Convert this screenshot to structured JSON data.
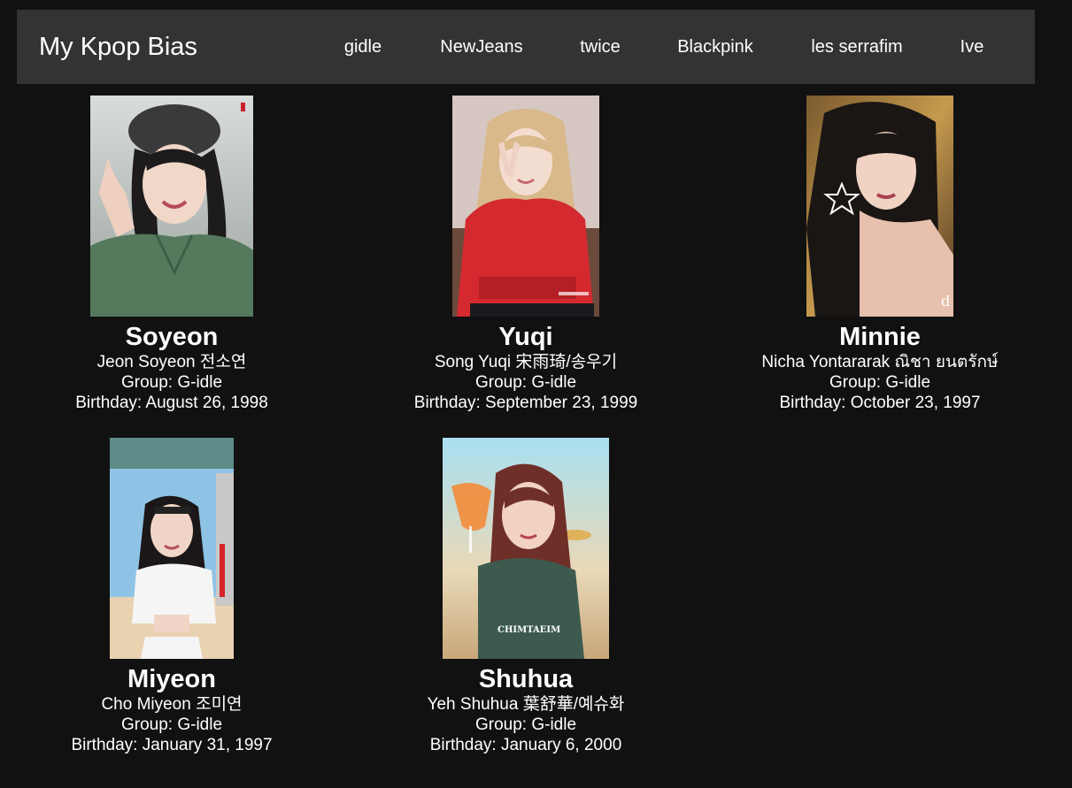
{
  "navbar": {
    "brand": "My Kpop Bias",
    "links": [
      "gidle",
      "NewJeans",
      "twice",
      "Blackpink",
      "les serrafim",
      "Ive"
    ]
  },
  "members": [
    {
      "name": "Soyeon",
      "full_name": "Jeon Soyeon 전소연",
      "group": "Group: G-idle",
      "birthday": "Birthday: August 26, 1998",
      "photo": "soyeon-photo"
    },
    {
      "name": "Yuqi",
      "full_name": "Song Yuqi 宋雨琦/송우기",
      "group": "Group: G-idle",
      "birthday": "Birthday: September 23, 1999",
      "photo": "yuqi-photo"
    },
    {
      "name": "Minnie",
      "full_name": "Nicha Yontararak ณิชา ยนตรักษ์",
      "group": "Group: G-idle",
      "birthday": "Birthday: October 23, 1997",
      "photo": "minnie-photo"
    },
    {
      "name": "Miyeon",
      "full_name": "Cho Miyeon 조미연",
      "group": "Group: G-idle",
      "birthday": "Birthday: January 31, 1997",
      "photo": "miyeon-photo"
    },
    {
      "name": "Shuhua",
      "full_name": "Yeh Shuhua 葉舒華/예슈화",
      "group": "Group: G-idle",
      "birthday": "Birthday: January 6, 2000",
      "photo": "shuhua-photo"
    }
  ],
  "colors": {
    "background": "#111111",
    "navbar": "#333333",
    "text": "#ffffff"
  }
}
